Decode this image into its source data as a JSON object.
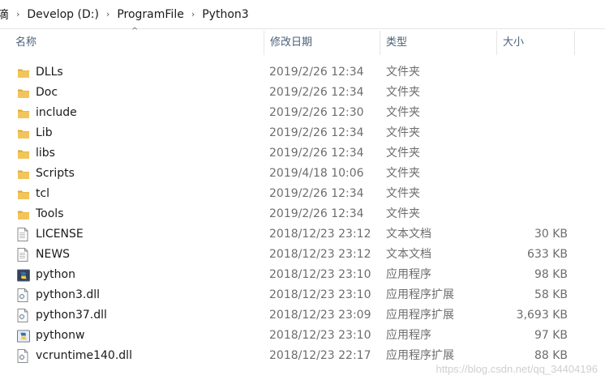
{
  "breadcrumb": {
    "items": [
      "滴",
      "Develop (D:)",
      "ProgramFile",
      "Python3"
    ],
    "separator": "›"
  },
  "columns": {
    "name": "名称",
    "date": "修改日期",
    "type": "类型",
    "size": "大小",
    "sort_arrow": "^"
  },
  "files": [
    {
      "name": "DLLs",
      "date": "2019/2/26 12:34",
      "type": "文件夹",
      "size": "",
      "icon": "folder-icon"
    },
    {
      "name": "Doc",
      "date": "2019/2/26 12:34",
      "type": "文件夹",
      "size": "",
      "icon": "folder-icon"
    },
    {
      "name": "include",
      "date": "2019/2/26 12:30",
      "type": "文件夹",
      "size": "",
      "icon": "folder-icon"
    },
    {
      "name": "Lib",
      "date": "2019/2/26 12:34",
      "type": "文件夹",
      "size": "",
      "icon": "folder-icon"
    },
    {
      "name": "libs",
      "date": "2019/2/26 12:34",
      "type": "文件夹",
      "size": "",
      "icon": "folder-icon"
    },
    {
      "name": "Scripts",
      "date": "2019/4/18 10:06",
      "type": "文件夹",
      "size": "",
      "icon": "folder-icon"
    },
    {
      "name": "tcl",
      "date": "2019/2/26 12:34",
      "type": "文件夹",
      "size": "",
      "icon": "folder-icon"
    },
    {
      "name": "Tools",
      "date": "2019/2/26 12:34",
      "type": "文件夹",
      "size": "",
      "icon": "folder-icon"
    },
    {
      "name": "LICENSE",
      "date": "2018/12/23 23:12",
      "type": "文本文档",
      "size": "30 KB",
      "icon": "text-file-icon"
    },
    {
      "name": "NEWS",
      "date": "2018/12/23 23:12",
      "type": "文本文档",
      "size": "633 KB",
      "icon": "text-file-icon"
    },
    {
      "name": "python",
      "date": "2018/12/23 23:10",
      "type": "应用程序",
      "size": "98 KB",
      "icon": "python-app-icon"
    },
    {
      "name": "python3.dll",
      "date": "2018/12/23 23:10",
      "type": "应用程序扩展",
      "size": "58 KB",
      "icon": "dll-file-icon"
    },
    {
      "name": "python37.dll",
      "date": "2018/12/23 23:09",
      "type": "应用程序扩展",
      "size": "3,693 KB",
      "icon": "dll-file-icon"
    },
    {
      "name": "pythonw",
      "date": "2018/12/23 23:10",
      "type": "应用程序",
      "size": "97 KB",
      "icon": "pythonw-app-icon"
    },
    {
      "name": "vcruntime140.dll",
      "date": "2018/12/23 22:17",
      "type": "应用程序扩展",
      "size": "88 KB",
      "icon": "dll-file-icon"
    }
  ],
  "colors": {
    "folder": "#f2c55c",
    "folder_dark": "#e0a82e",
    "python_blue": "#3771a6",
    "python_yellow": "#f2c94c",
    "header_text": "#4c607a"
  },
  "watermark": "https://blog.csdn.net/qq_34404196"
}
